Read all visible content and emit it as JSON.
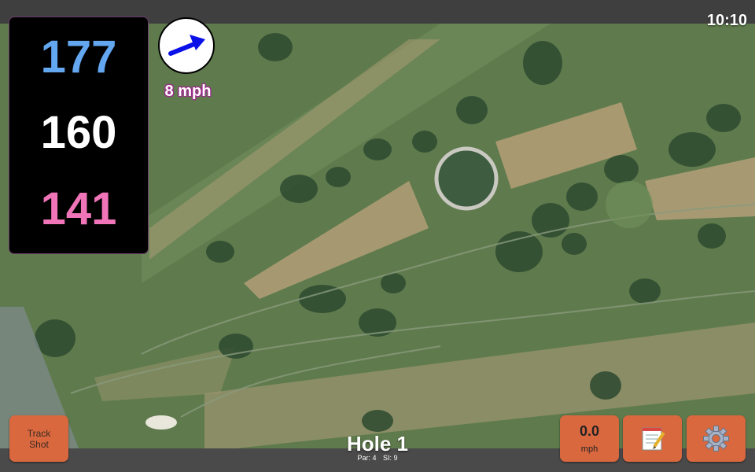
{
  "status": {
    "time": "10:10"
  },
  "distances": {
    "back": "177",
    "middle": "160",
    "front": "141"
  },
  "wind": {
    "speed_label": "8 mph",
    "direction_icon": "arrow-icon",
    "arrow_color": "#0a10e8"
  },
  "buttons": {
    "track_shot_line1": "Track",
    "track_shot_line2": "Shot",
    "speed_value": "0.0",
    "speed_unit": "mph",
    "notes_icon": "notepad-icon",
    "settings_icon": "gear-icon"
  },
  "hole": {
    "title": "Hole 1",
    "par": "Par: 4",
    "si": "SI: 9"
  },
  "colors": {
    "back": "#63a7f0",
    "middle": "#ffffff",
    "front": "#f074b8",
    "button": "#d9683f"
  }
}
